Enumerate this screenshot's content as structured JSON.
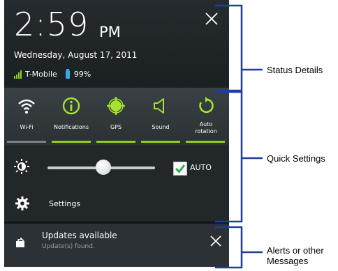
{
  "status": {
    "time": "2:59",
    "ampm": "PM",
    "date": "Wednesday, August 17, 2011",
    "carrier": "T-Mobile",
    "battery": "99%"
  },
  "quick_settings": [
    {
      "label": "Wi-Fi",
      "icon": "wifi-icon",
      "active": false
    },
    {
      "label": "Notifications",
      "icon": "notifications-icon",
      "active": true
    },
    {
      "label": "GPS",
      "icon": "gps-icon",
      "active": true
    },
    {
      "label": "Sound",
      "icon": "sound-icon",
      "active": true
    },
    {
      "label": "Auto rotation",
      "icon": "auto-rotation-icon",
      "active": true
    }
  ],
  "brightness": {
    "auto_label": "AUTO",
    "auto_checked": true,
    "level": 0.52
  },
  "settings": {
    "label": "Settings"
  },
  "notification": {
    "title": "Updates available",
    "subtitle": "Update(s) found."
  },
  "annotations": {
    "status_details": "Status Details",
    "quick_settings": "Quick Settings",
    "alerts": "Alerts or other Messages"
  },
  "colors": {
    "accent_green": "#8ccf1e",
    "annotation_blue": "#1d3f9c",
    "panel": "#1f2527"
  }
}
